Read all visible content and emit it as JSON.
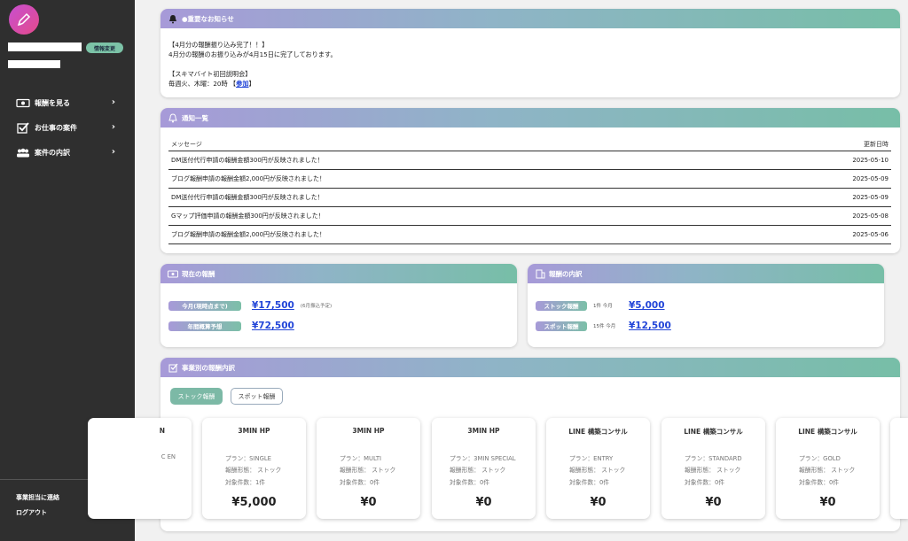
{
  "sidebar": {
    "profile_button": "情報変更",
    "nav": [
      {
        "label": "報酬を見る"
      },
      {
        "label": "お仕事の案件"
      },
      {
        "label": "案件の内訳"
      }
    ],
    "contact_link": "事業担当に連絡",
    "logout_link": "ログアウト"
  },
  "notice": {
    "title": "●重要なお知らせ",
    "line1": "【4月分の報酬振り込み完了！！】",
    "line2": "4月分の報酬のお振り込みが4月15日に完了しております。",
    "line3": "【スキマバイト初回説明会】",
    "line4_prefix": "毎週火、木曜：20時 【",
    "line4_link": "参加",
    "line4_suffix": "】"
  },
  "notifications": {
    "title": "通知一覧",
    "col_message": "メッセージ",
    "col_date": "更新日時",
    "rows": [
      {
        "message": "DM送付代行申請の報酬金額300円が反映されました！",
        "date": "2025-05-10"
      },
      {
        "message": "ブログ報酬申請の報酬金額2,000円が反映されました！",
        "date": "2025-05-09"
      },
      {
        "message": "DM送付代行申請の報酬金額300円が反映されました！",
        "date": "2025-05-09"
      },
      {
        "message": "Gマップ評価申請の報酬金額300円が反映されました！",
        "date": "2025-05-08"
      },
      {
        "message": "ブログ報酬申請の報酬金額2,000円が反映されました！",
        "date": "2025-05-06"
      }
    ]
  },
  "current_pay": {
    "title": "現在の報酬",
    "month_label": "今月(現時点まで)",
    "month_amount": "¥17,500",
    "month_note": "(6月振込予定)",
    "year_label": "年間概算予想",
    "year_amount": "¥72,500"
  },
  "pay_breakdown": {
    "title": "報酬の内訳",
    "stock_label": "ストック報酬",
    "stock_count": "1件 今月",
    "stock_amount": "¥5,000",
    "spot_label": "スポット報酬",
    "spot_count": "15件 今月",
    "spot_amount": "¥12,500"
  },
  "business": {
    "title": "事業別の報酬内訳",
    "tab_stock": "ストック報酬",
    "tab_spot": "スポット報酬",
    "partial_card": {
      "title_fragment": "N",
      "line_fragment": "C EN"
    },
    "plans": [
      {
        "title": "3MIN HP",
        "plan": "プラン：SINGLE",
        "form": "報酬形態： ストック",
        "count": "対象件数：1件",
        "price": "¥5,000"
      },
      {
        "title": "3MIN HP",
        "plan": "プラン：MULTI",
        "form": "報酬形態： ストック",
        "count": "対象件数：0件",
        "price": "¥0"
      },
      {
        "title": "3MIN HP",
        "plan": "プラン：3MIN SPECIAL",
        "form": "報酬形態： ストック",
        "count": "対象件数：0件",
        "price": "¥0"
      },
      {
        "title": "LINE 構築コンサル",
        "plan": "プラン：ENTRY",
        "form": "報酬形態： ストック",
        "count": "対象件数：0件",
        "price": "¥0"
      },
      {
        "title": "LINE 構築コンサル",
        "plan": "プラン：STANDARD",
        "form": "報酬形態： ストック",
        "count": "対象件数：0件",
        "price": "¥0"
      },
      {
        "title": "LINE 構築コンサル",
        "plan": "プラン：GOLD",
        "form": "報酬形態： ストック",
        "count": "対象件数：0件",
        "price": "¥0"
      }
    ]
  }
}
